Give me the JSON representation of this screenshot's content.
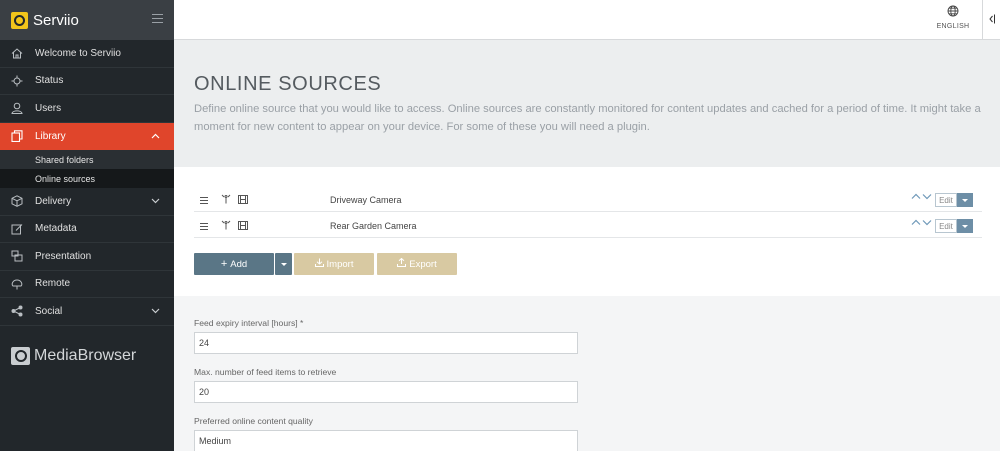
{
  "app": {
    "name": "Serviio"
  },
  "nav": {
    "items": [
      {
        "label": "Welcome to Serviio",
        "icon": "home-icon"
      },
      {
        "label": "Status",
        "icon": "status-icon"
      },
      {
        "label": "Users",
        "icon": "users-icon"
      },
      {
        "label": "Library",
        "icon": "library-icon"
      },
      {
        "label": "Delivery",
        "icon": "box-icon"
      },
      {
        "label": "Metadata",
        "icon": "edit-icon"
      },
      {
        "label": "Presentation",
        "icon": "presentation-icon"
      },
      {
        "label": "Remote",
        "icon": "remote-icon"
      },
      {
        "label": "Social",
        "icon": "share-icon"
      }
    ],
    "library_sub": [
      "Shared folders",
      "Online sources"
    ],
    "active_color": "#e0452b"
  },
  "sidebar_footer": {
    "brand": "MediaBrowser"
  },
  "topbar": {
    "language_label": "ENGLISH"
  },
  "page": {
    "title": "ONLINE SOURCES",
    "description": "Define online source that you would like to access. Online sources are constantly monitored for content updates and cached for a period of time. It might take a moment for new content to appear on your device. For some of these you will need a plugin."
  },
  "sources": [
    {
      "name": "Driveway Camera",
      "edit_label": "Edit"
    },
    {
      "name": "Rear Garden Camera",
      "edit_label": "Edit"
    }
  ],
  "actions": {
    "add": "Add",
    "import": "Import",
    "export": "Export"
  },
  "form": {
    "expiry_label": "Feed expiry interval [hours] *",
    "expiry_value": "24",
    "max_items_label": "Max. number of feed items to retrieve",
    "max_items_value": "20",
    "quality_label": "Preferred online content quality",
    "quality_value": "Medium"
  }
}
